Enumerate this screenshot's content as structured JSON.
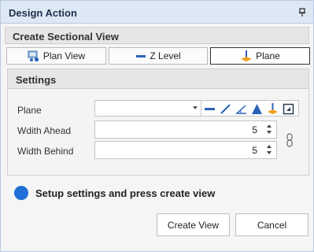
{
  "window": {
    "title": "Design Action",
    "pin_icon": "pin-icon"
  },
  "section": {
    "title": "Create Sectional View"
  },
  "view_buttons": [
    {
      "label": "Plan View",
      "icon": "plan-view-icon"
    },
    {
      "label": "Z Level",
      "icon": "z-level-icon"
    },
    {
      "label": "Plane",
      "icon": "plane-icon",
      "selected": true
    }
  ],
  "settings": {
    "title": "Settings",
    "plane_label": "Plane",
    "plane_value": "",
    "plane_tools": [
      "horizontal-line-icon",
      "diagonal-line-icon",
      "angle-icon",
      "triangle-icon",
      "plane-icon",
      "frame-icon"
    ],
    "width_ahead_label": "Wdith Ahead",
    "width_ahead_value": "5",
    "width_behind_label": "Width Behind",
    "width_behind_value": "5",
    "link_icon": "chain-link-icon"
  },
  "status": {
    "text": "Setup settings and press create view",
    "color": "#1f6fd6"
  },
  "actions": {
    "create_label": "Create View",
    "cancel_label": "Cancel"
  },
  "colors": {
    "titlebar": "#dde8f5",
    "accent": "#2a63b8",
    "orange": "#f0a020"
  }
}
